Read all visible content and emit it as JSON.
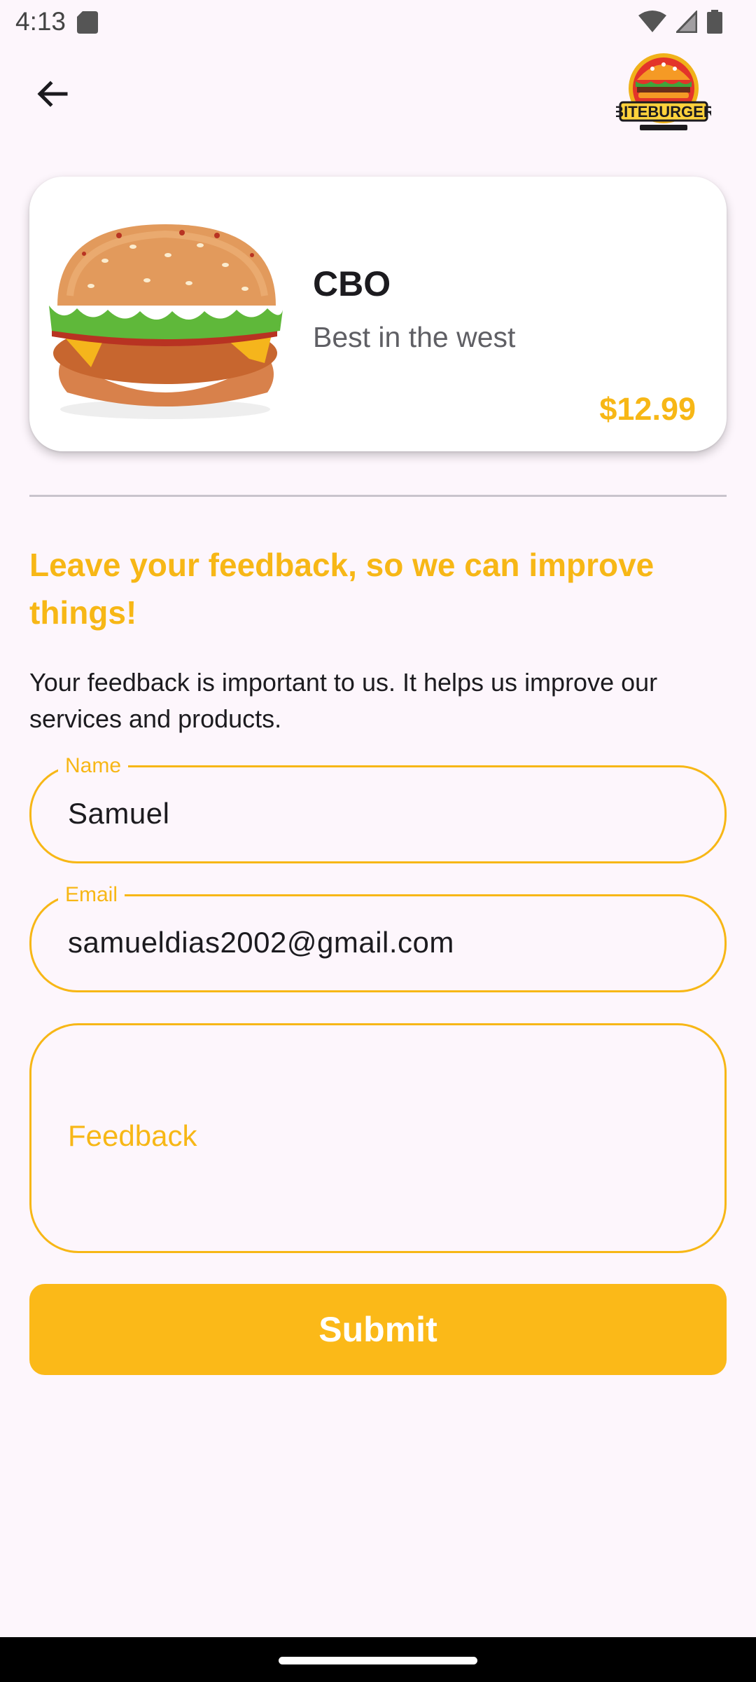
{
  "status_bar": {
    "time": "4:13",
    "icons": [
      "sd-card-icon",
      "wifi-icon",
      "signal-icon",
      "battery-icon"
    ]
  },
  "app_bar": {
    "back_icon": "arrow-back-icon",
    "logo_text": "BITEBURGER"
  },
  "product": {
    "name": "CBO",
    "description": "Best in the west",
    "price": "$12.99"
  },
  "feedback": {
    "heading": "Leave your feedback, so we can improve things!",
    "intro": "Your feedback is important to us. It helps us improve our services and products."
  },
  "form": {
    "name_label": "Name",
    "name_value": "Samuel",
    "email_label": "Email",
    "email_value": "samueldias2002@gmail.com",
    "feedback_placeholder": "Feedback",
    "submit_label": "Submit"
  },
  "colors": {
    "accent": "#f7b716",
    "background": "#fdf6fc",
    "card": "#ffffff"
  }
}
